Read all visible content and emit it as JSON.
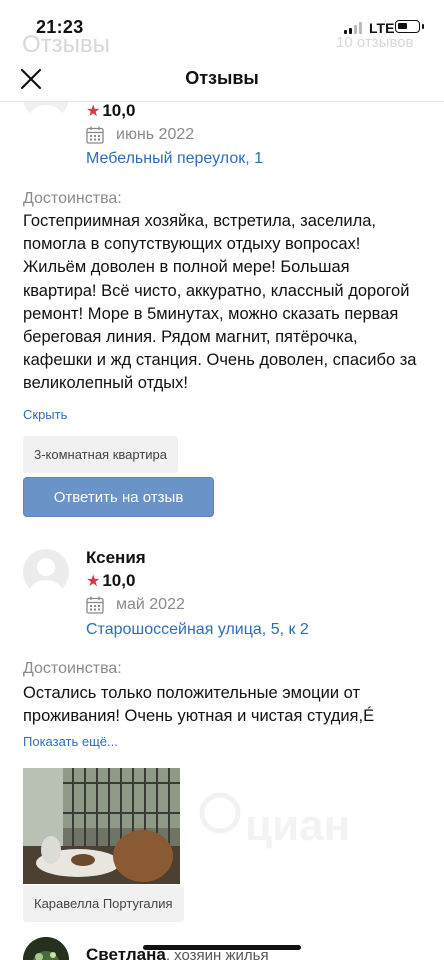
{
  "status_bar": {
    "time": "21:23",
    "network": "LTE"
  },
  "background": {
    "title": "Отзывы",
    "count": "10 отзывов"
  },
  "header": {
    "title": "Отзывы"
  },
  "review1": {
    "rating": "10,0",
    "date": "июнь 2022",
    "address": "Мебельный переулок, 1",
    "pros_label": "Достоинства:",
    "text": "Гостеприимная хозяйка, встретила, заселила, помогла в сопутствующих отдыху вопросах! Жильём доволен в полной мере! Большая квартира! Всё чисто, аккуратно, классный дорогой ремонт! Море в 5минутах, можно сказать первая береговая линия. Рядом магнит, пятёрочка, кафешки и жд станция. Очень доволен, спасибо за великолепный отдых!",
    "collapse_link": "Скрыть",
    "tag": "3-комнатная квартира",
    "reply_button": "Ответить на отзыв"
  },
  "review2": {
    "author": "Ксения",
    "rating": "10,0",
    "date": "май 2022",
    "address": "Старошоссейная улица, 5, к 2",
    "pros_label": "Достоинства:",
    "text": "Остались только положительные эмоции от проживания! Очень уютная и чистая студия,É",
    "expand_link": "Показать ещё...",
    "tag": "Каравелла Португалия"
  },
  "review3": {
    "author": "Светлана",
    "role": ", хозяин жилья"
  },
  "colors": {
    "link": "#2f6dba",
    "star": "#e03545",
    "button": "#6a94c7"
  }
}
